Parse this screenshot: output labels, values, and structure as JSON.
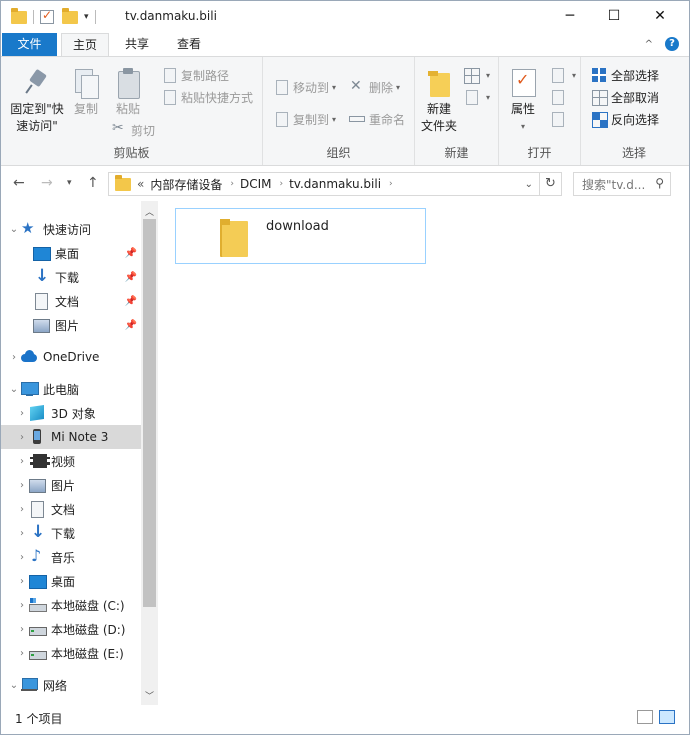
{
  "window": {
    "title": "tv.danmaku.bili",
    "minimize": "─",
    "maximize": "☐",
    "close": "✕"
  },
  "ribbon_tabs": {
    "file": "文件",
    "home": "主页",
    "share": "共享",
    "view": "查看"
  },
  "ribbon": {
    "clipboard": {
      "label": "剪贴板",
      "pin": "固定到\"快速访问\"",
      "copy": "复制",
      "paste": "粘贴",
      "copy_path": "复制路径",
      "paste_shortcut": "粘贴快捷方式",
      "cut": "剪切"
    },
    "organize": {
      "label": "组织",
      "move_to": "移动到",
      "copy_to": "复制到",
      "delete": "删除",
      "rename": "重命名"
    },
    "new": {
      "label": "新建",
      "new_folder": "新建\n文件夹"
    },
    "open": {
      "label": "打开",
      "properties": "属性"
    },
    "select": {
      "label": "选择",
      "select_all": "全部选择",
      "select_none": "全部取消",
      "invert": "反向选择"
    }
  },
  "address": {
    "overflow": "«",
    "crumbs": [
      "内部存储设备",
      "DCIM",
      "tv.danmaku.bili"
    ],
    "search_placeholder": "搜索\"tv.d..."
  },
  "nav": {
    "quick_access": "快速访问",
    "quick_items": [
      "桌面",
      "下载",
      "文档",
      "图片"
    ],
    "onedrive": "OneDrive",
    "this_pc": "此电脑",
    "pc_items": [
      "3D 对象",
      "Mi Note 3",
      "视频",
      "图片",
      "文档",
      "下载",
      "音乐",
      "桌面",
      "本地磁盘 (C:)",
      "本地磁盘 (D:)",
      "本地磁盘 (E:)"
    ],
    "network": "网络",
    "selected": "Mi Note 3"
  },
  "content": {
    "items": [
      {
        "name": "download",
        "type": "folder"
      }
    ]
  },
  "status": {
    "count": "1 个项目"
  },
  "colors": {
    "accent": "#1979ca",
    "selection_border": "#99d1ff",
    "folder": "#f4cc55"
  }
}
